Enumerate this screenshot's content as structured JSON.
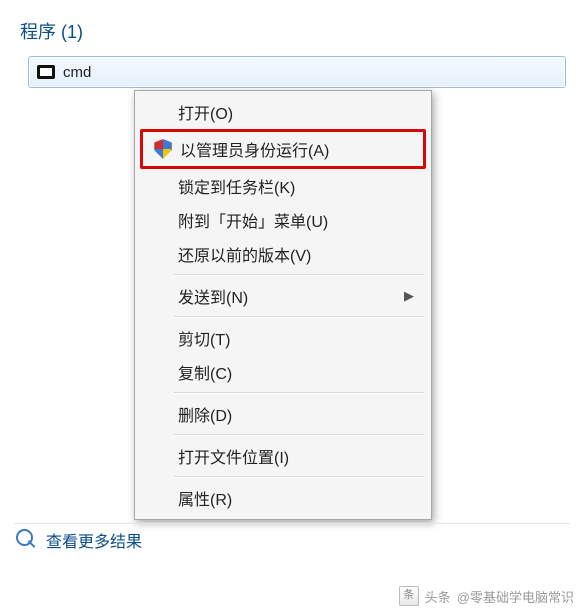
{
  "header": {
    "title": "程序 (1)"
  },
  "result": {
    "label": "cmd"
  },
  "contextMenu": {
    "open": "打开(O)",
    "runAsAdmin": "以管理员身份运行(A)",
    "pinTaskbar": "锁定到任务栏(K)",
    "pinStart": "附到「开始」菜单(U)",
    "restorePrev": "还原以前的版本(V)",
    "sendTo": "发送到(N)",
    "cut": "剪切(T)",
    "copy": "复制(C)",
    "delete": "删除(D)",
    "openLocation": "打开文件位置(I)",
    "properties": "属性(R)"
  },
  "moreResults": {
    "label": "查看更多结果"
  },
  "watermark": {
    "prefix": "头条",
    "text": "@零基础学电脑常识"
  }
}
